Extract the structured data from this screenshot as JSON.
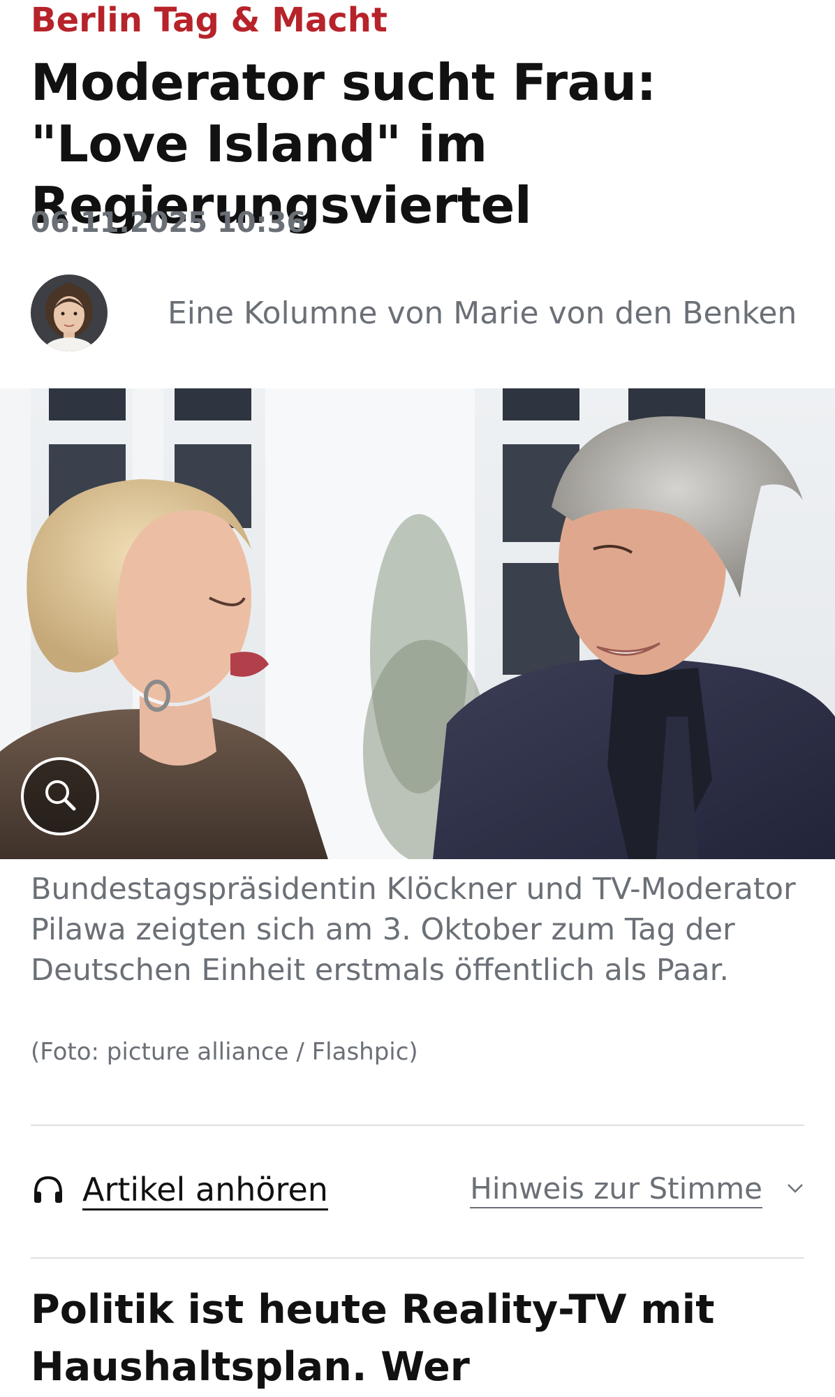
{
  "article": {
    "kicker": "Berlin Tag & Macht",
    "headline": "Moderator sucht Frau: \"Love Island\" im Regierungsviertel",
    "timestamp": "06.11.2025 10:36",
    "author_line": "Eine Kolumne von Marie von den Benken"
  },
  "image": {
    "caption": "Bundestagspräsidentin Klöckner und TV-Moderator Pilawa zeigten sich am 3. Oktober zum Tag der Deutschen Einheit erstmals öffentlich als Paar.",
    "credit": "(Foto: picture alliance / Flashpic)",
    "zoom_icon": "magnifier-icon"
  },
  "audio": {
    "listen_label": "Artikel anhören",
    "listen_icon": "headphones-icon",
    "voice_note_label": "Hinweis zur Stimme",
    "voice_note_icon": "chevron-down-icon"
  },
  "body": {
    "lead": "Politik ist heute Reality-TV mit Haushaltsplan. Wer Aufmerksamkeit"
  },
  "colors": {
    "kicker": "#b7232a",
    "text": "#111111",
    "muted": "#6b7077",
    "divider": "#e0e0e0"
  }
}
